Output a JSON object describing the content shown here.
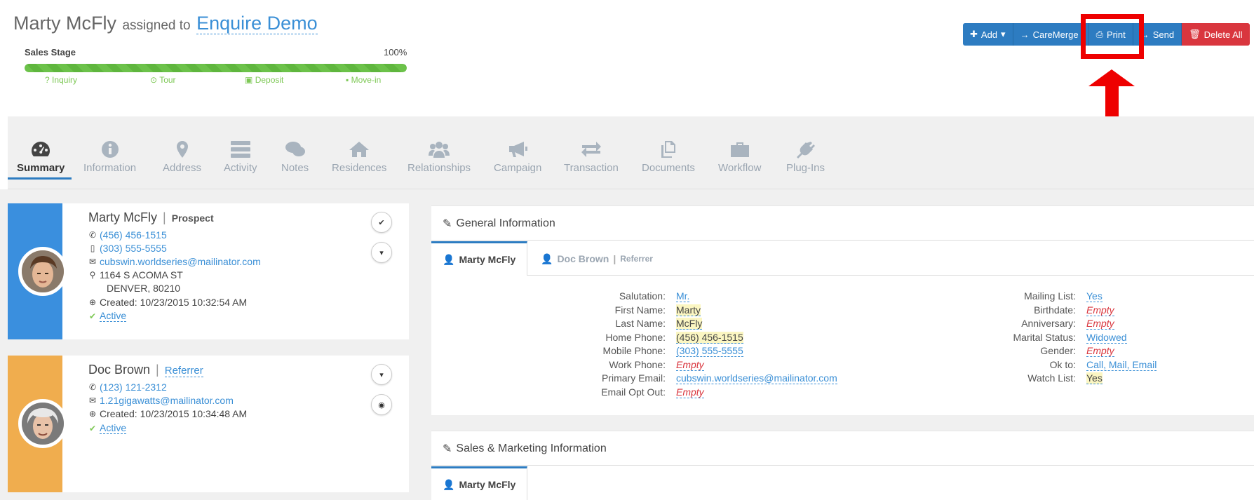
{
  "header": {
    "name": "Marty McFly",
    "assigned_text": "assigned to",
    "assigned_link": "Enquire Demo",
    "stage_label": "Sales Stage",
    "stage_percent": "100%",
    "stage_progress": 1.0,
    "stage_steps": [
      {
        "label": "Inquiry",
        "icon": "question-icon"
      },
      {
        "label": "Tour",
        "icon": "clock-icon"
      },
      {
        "label": "Deposit",
        "icon": "money-icon"
      },
      {
        "label": "Move-in",
        "icon": "briefcase-icon"
      }
    ]
  },
  "toolbar": {
    "add": "Add",
    "caremerge": "CareMerge",
    "print": "Print",
    "send": "Send",
    "delete_all": "Delete All"
  },
  "tabs": [
    {
      "label": "Summary",
      "icon": "dashboard-icon"
    },
    {
      "label": "Information",
      "icon": "info-icon"
    },
    {
      "label": "Address",
      "icon": "map-marker-icon"
    },
    {
      "label": "Activity",
      "icon": "tasks-icon"
    },
    {
      "label": "Notes",
      "icon": "comments-icon"
    },
    {
      "label": "Residences",
      "icon": "home-icon"
    },
    {
      "label": "Relationships",
      "icon": "users-icon"
    },
    {
      "label": "Campaign",
      "icon": "bullhorn-icon"
    },
    {
      "label": "Transaction",
      "icon": "exchange-icon"
    },
    {
      "label": "Documents",
      "icon": "copy-icon"
    },
    {
      "label": "Workflow",
      "icon": "briefcase-icon"
    },
    {
      "label": "Plug-Ins",
      "icon": "plug-icon"
    }
  ],
  "contacts": [
    {
      "name": "Marty McFly",
      "role": "Prospect",
      "home_phone": "(456) 456-1515",
      "mobile_phone": "(303) 555-5555",
      "email": "cubswin.worldseries@mailinator.com",
      "address_line1": "1164 S ACOMA ST",
      "address_line2": "DENVER, 80210",
      "created": "Created: 10/23/2015 10:32:54 AM",
      "status": "Active",
      "bar_color": "#3a8fde"
    },
    {
      "name": "Doc Brown",
      "role": "Referrer",
      "home_phone": "(123) 121-2312",
      "email": "1.21gigawatts@mailinator.com",
      "created": "Created: 10/23/2015 10:34:48 AM",
      "status": "Active",
      "bar_color": "#f0ad4e"
    }
  ],
  "general_info": {
    "title": "General Information",
    "subtabs": [
      {
        "label": "Marty McFly"
      },
      {
        "label": "Doc Brown",
        "role": "Referrer"
      }
    ],
    "left_fields": [
      {
        "label": "Salutation:",
        "value": "Mr."
      },
      {
        "label": "First Name:",
        "value": "Marty"
      },
      {
        "label": "Last Name:",
        "value": "McFly"
      },
      {
        "label": "Home Phone:",
        "value": "(456) 456-1515"
      },
      {
        "label": "Mobile Phone:",
        "value": "(303) 555-5555"
      },
      {
        "label": "Work Phone:",
        "value": "Empty"
      },
      {
        "label": "Primary Email:",
        "value": "cubswin.worldseries@mailinator.com"
      },
      {
        "label": "Email Opt Out:",
        "value": "Empty"
      }
    ],
    "right_fields": [
      {
        "label": "Mailing List:",
        "value": "Yes"
      },
      {
        "label": "Birthdate:",
        "value": "Empty"
      },
      {
        "label": "Anniversary:",
        "value": "Empty"
      },
      {
        "label": "Marital Status:",
        "value": "Widowed"
      },
      {
        "label": "Gender:",
        "value": "Empty"
      },
      {
        "label": "Ok to:",
        "value": "Call, Mail, Email"
      },
      {
        "label": "Watch List:",
        "value": "Yes"
      }
    ]
  },
  "sales_marketing": {
    "title": "Sales & Marketing Information",
    "subtab": "Marty McFly"
  }
}
